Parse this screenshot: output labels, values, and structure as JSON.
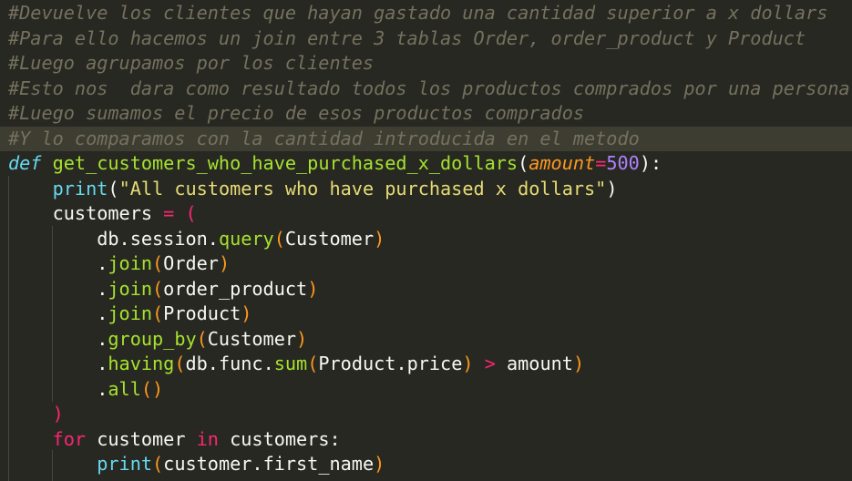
{
  "comments": [
    "#Devuelve los clientes que hayan gastado una cantidad superior a x dollars",
    "#Para ello hacemos un join entre 3 tablas Order, order_product y Product",
    "#Luego agrupamos por los clientes",
    "#Esto nos  dara como resultado todos los productos comprados por una persona",
    "#Luego sumamos el precio de esos productos comprados",
    "#Y lo comparamos con la cantidad introducida en el metodo"
  ],
  "def_line": {
    "keyword": "def",
    "name": "get_customers_who_have_purchased_x_dollars",
    "open": "(",
    "param": "amount",
    "eq": "=",
    "default": "500",
    "close": "):"
  },
  "print_line": {
    "func": "print",
    "open": "(",
    "string": "\"All customers who have purchased x dollars\"",
    "close": ")"
  },
  "assign_line": {
    "var": "customers",
    "eq": "=",
    "open": "("
  },
  "query_line": {
    "obj": "db",
    "attr": "session",
    "method": "query",
    "open": "(",
    "arg": "Customer",
    "close": ")"
  },
  "join_lines": [
    {
      "method": "join",
      "open": "(",
      "arg": "Order",
      "close": ")"
    },
    {
      "method": "join",
      "open": "(",
      "arg": "order_product",
      "close": ")"
    },
    {
      "method": "join",
      "open": "(",
      "arg": "Product",
      "close": ")"
    }
  ],
  "group_line": {
    "method": "group_by",
    "open": "(",
    "arg": "Customer",
    "close": ")"
  },
  "having_line": {
    "method": "having",
    "open": "(",
    "obj": "db",
    "attr": "func",
    "fn": "sum",
    "open2": "(",
    "arg_obj": "Product",
    "arg_attr": "price",
    "close2": ")",
    "op": ">",
    "rhs": "amount",
    "close": ")"
  },
  "all_line": {
    "method": "all",
    "parens": "()"
  },
  "close_paren": ")",
  "for_line": {
    "kw": "for",
    "var": "customer",
    "in_kw": "in",
    "iter": "customers",
    "colon": ":"
  },
  "inner_print": {
    "func": "print",
    "open": "(",
    "obj": "customer",
    "attr": "first_name",
    "close": ")"
  },
  "theme_colors": {
    "background": "#272822",
    "current_line": "#3e3d32",
    "comment": "#75715e",
    "keyword": "#66d9ef",
    "function": "#a6e22e",
    "parameter": "#fd971f",
    "operator": "#f92672",
    "number": "#ae81ff",
    "string": "#e6db74",
    "text": "#f8f8f2"
  }
}
